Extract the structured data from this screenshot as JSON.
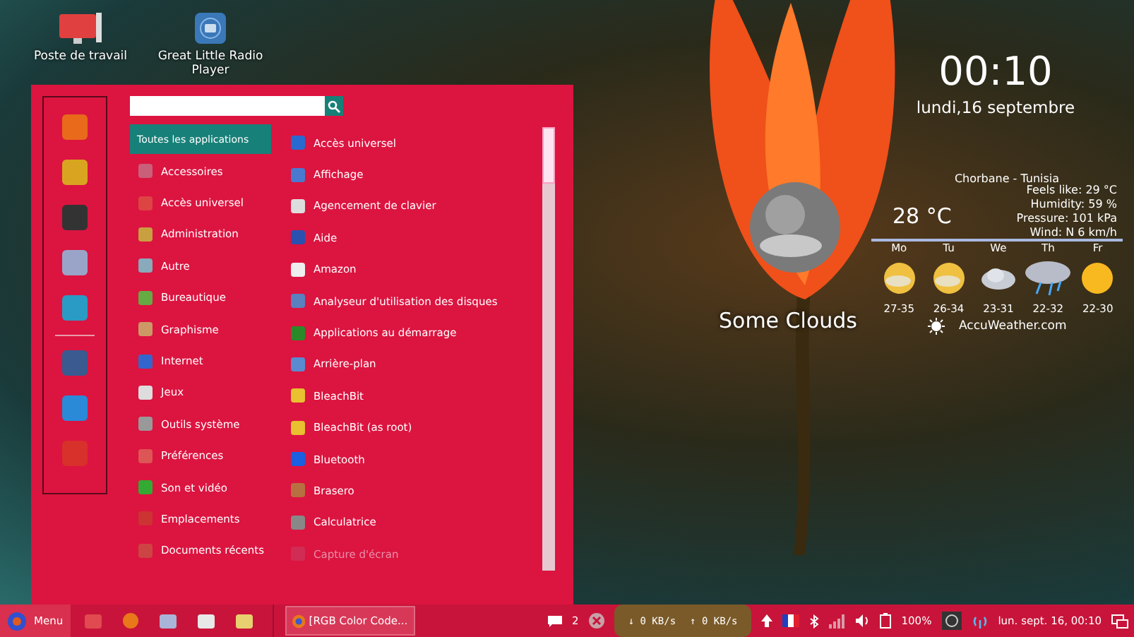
{
  "desktop_icons": [
    {
      "label": "Poste de travail",
      "kind": "monitor"
    },
    {
      "label": "Great Little Radio Player",
      "kind": "radio"
    }
  ],
  "clock": {
    "time": "00:10",
    "date": "lundi,16 septembre"
  },
  "weather": {
    "condition": "Some Clouds",
    "location": "Chorbane - Tunisia",
    "temperature": "28 °C",
    "details": [
      "Feels like: 29 °C",
      "Humidity: 59 %",
      "Pressure: 101 kPa",
      "Wind: N 6 km/h"
    ],
    "forecast": [
      {
        "day": "Mo",
        "range": "27-35",
        "kind": "partly"
      },
      {
        "day": "Tu",
        "range": "26-34",
        "kind": "partly"
      },
      {
        "day": "We",
        "range": "23-31",
        "kind": "cloud"
      },
      {
        "day": "Th",
        "range": "22-32",
        "kind": "storm"
      },
      {
        "day": "Fr",
        "range": "22-30",
        "kind": "sun"
      }
    ],
    "source": "AccuWeather.com"
  },
  "menu": {
    "categories": [
      {
        "label": "Toutes les applications",
        "selected": true
      },
      {
        "label": "Accessoires",
        "selected": false
      },
      {
        "label": "Accès universel",
        "selected": false
      },
      {
        "label": "Administration",
        "selected": false
      },
      {
        "label": "Autre",
        "selected": false
      },
      {
        "label": "Bureautique",
        "selected": false
      },
      {
        "label": "Graphisme",
        "selected": false
      },
      {
        "label": "Internet",
        "selected": false
      },
      {
        "label": "Jeux",
        "selected": false
      },
      {
        "label": "Outils système",
        "selected": false
      },
      {
        "label": "Préférences",
        "selected": false
      },
      {
        "label": "Son et vidéo",
        "selected": false
      },
      {
        "label": "Emplacements",
        "selected": false
      },
      {
        "label": "Documents récents",
        "selected": false
      }
    ],
    "apps": [
      {
        "label": "Accès universel",
        "disabled": false
      },
      {
        "label": "Affichage",
        "disabled": false
      },
      {
        "label": "Agencement de clavier",
        "disabled": false
      },
      {
        "label": "Aide",
        "disabled": false
      },
      {
        "label": "Amazon",
        "disabled": false
      },
      {
        "label": "Analyseur d'utilisation des disques",
        "disabled": false
      },
      {
        "label": "Applications au démarrage",
        "disabled": false
      },
      {
        "label": "Arrière-plan",
        "disabled": false
      },
      {
        "label": "BleachBit",
        "disabled": false
      },
      {
        "label": "BleachBit (as root)",
        "disabled": false
      },
      {
        "label": "Bluetooth",
        "disabled": false
      },
      {
        "label": "Brasero",
        "disabled": false
      },
      {
        "label": "Calculatrice",
        "disabled": false
      },
      {
        "label": "Capture d'écran",
        "disabled": true
      }
    ]
  },
  "taskbar": {
    "menu_label": "Menu",
    "window_title": "[RGB Color Code...",
    "notifications": "2",
    "net_down": "↓ 0 KB/s",
    "net_up": "↑ 0 KB/s",
    "battery": "100%",
    "datetime": "lun. sept. 16, 00:10"
  }
}
